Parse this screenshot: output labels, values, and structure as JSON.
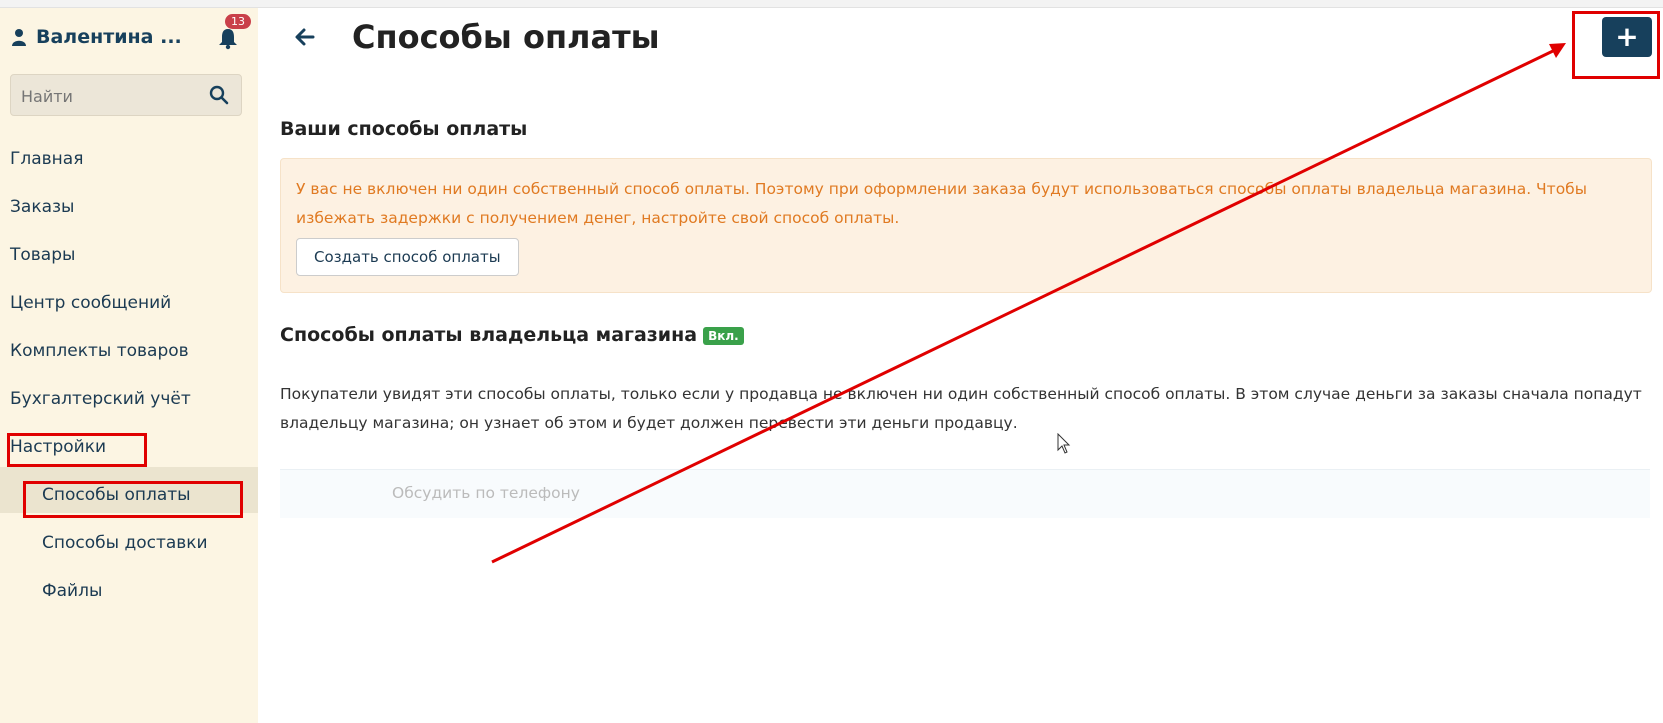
{
  "sidebar": {
    "user_name": "Валентина ...",
    "notifications_count": "13",
    "search_placeholder": "Найти",
    "items": [
      {
        "label": "Главная"
      },
      {
        "label": "Заказы"
      },
      {
        "label": "Товары"
      },
      {
        "label": "Центр сообщений"
      },
      {
        "label": "Комплекты товаров"
      },
      {
        "label": "Бухгалтерский учёт"
      },
      {
        "label": "Настройки"
      }
    ],
    "sub_items": [
      {
        "label": "Способы оплаты",
        "active": true
      },
      {
        "label": "Способы доставки"
      },
      {
        "label": "Файлы"
      }
    ]
  },
  "main": {
    "title": "Способы оплаты",
    "add_button_label": "+",
    "own_section": {
      "heading": "Ваши способы оплаты",
      "alert_text": "У вас не включен ни один собственный способ оплаты. Поэтому при оформлении заказа будут использоваться способы оплаты владельца магазина. Чтобы избежать задержки с получением денег, настройте свой способ оплаты.",
      "create_button": "Создать способ оплаты"
    },
    "owner_section": {
      "heading": "Способы оплаты владельца магазина",
      "badge": "Вкл.",
      "description": "Покупатели увидят эти способы оплаты, только если у продавца не включен ни один собственный способ оплаты. В этом случае деньги за заказы сначала попадут владельцу магазина; он узнает об этом и будет должен перевести эти деньги продавцу.",
      "methods": [
        {
          "name": "Обсудить по телефону"
        }
      ]
    }
  },
  "colors": {
    "annotation_red": "#e00000",
    "primary": "#17405c",
    "warning_text": "#e07a22",
    "success_badge": "#3aa14a"
  }
}
